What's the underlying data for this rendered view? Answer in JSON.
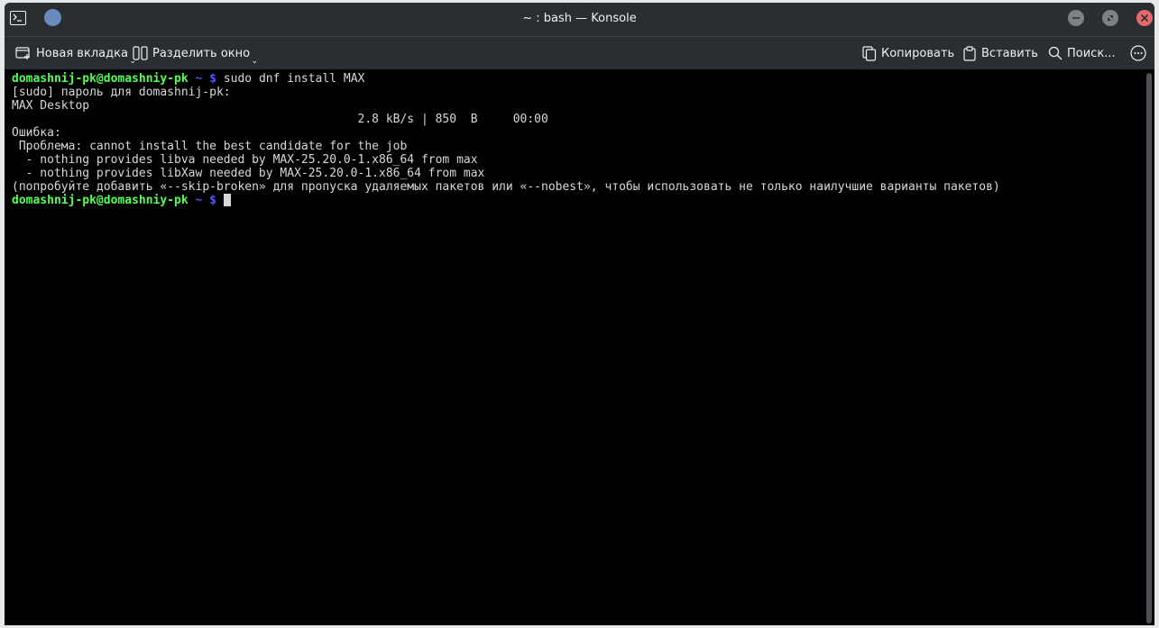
{
  "window": {
    "title": "~ : bash — Konsole"
  },
  "toolbar": {
    "new_tab_label": "Новая вкладка",
    "split_view_label": "Разделить окно",
    "copy_label": "Копировать",
    "paste_label": "Вставить",
    "find_label": "Поиск..."
  },
  "terminal": {
    "prompt_user": "domashnij-pk@domashniy-pk",
    "prompt_path": "~",
    "prompt_symbol": "$",
    "command": "sudo dnf install MAX",
    "output": [
      "[sudo] пароль для domashnij-pk:",
      "MAX Desktop",
      "                                                 2.8 kB/s | 850  B     00:00",
      "Ошибка:",
      " Проблема: cannot install the best candidate for the job",
      "  - nothing provides libva needed by MAX-25.20.0-1.x86_64 from max",
      "  - nothing provides libXaw needed by MAX-25.20.0-1.x86_64 from max",
      "(попробуйте добавить «--skip-broken» для пропуска удаляемых пакетов или «--nobest», чтобы использовать не только наилучшие варианты пакетов)"
    ]
  },
  "icons": {
    "app": "terminal-icon",
    "new_tab": "new-tab-icon",
    "split": "split-view-icon",
    "copy": "copy-icon",
    "paste": "clipboard-icon",
    "find": "search-icon",
    "menu": "more-icon"
  },
  "colors": {
    "prompt_user": "#54ff54",
    "prompt_path": "#5555ff",
    "close_button": "#e46a6a"
  }
}
